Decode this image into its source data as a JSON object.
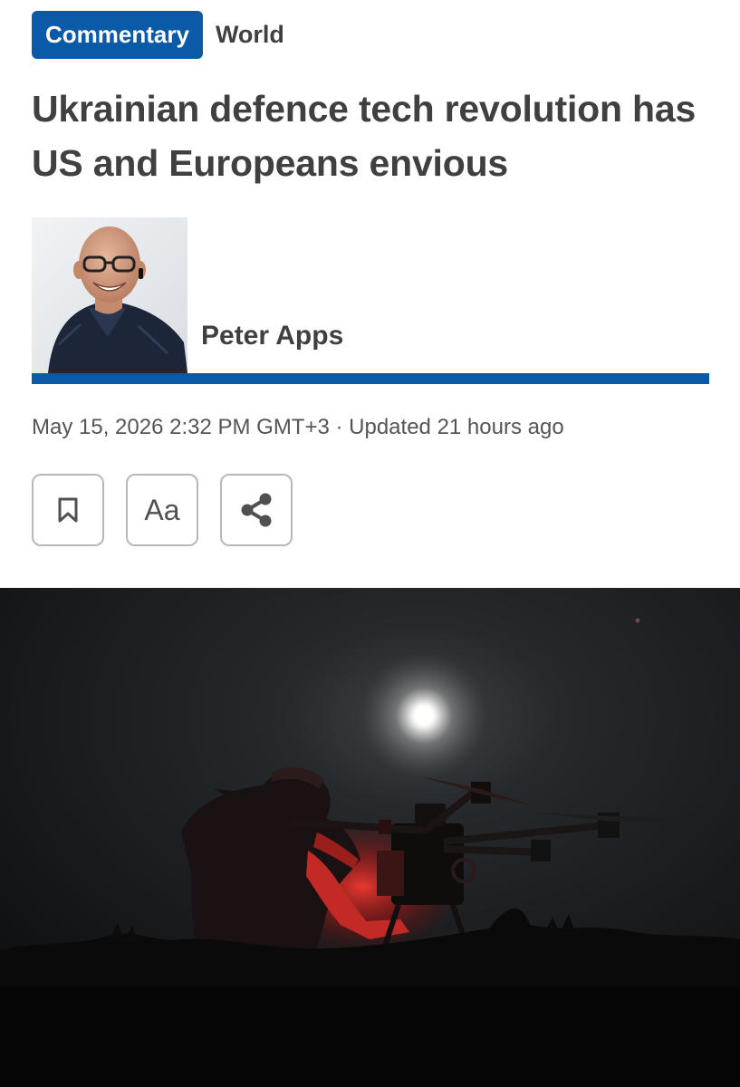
{
  "tags": {
    "primary": "Commentary",
    "secondary": "World"
  },
  "headline": "Ukrainian defence tech revolution has US and Europeans envious",
  "author": {
    "name": "Peter Apps"
  },
  "dateline": "May 15, 2026 2:32 PM GMT+3 · Updated 21 hours ago",
  "toolbar": {
    "font_size_label": "Aa",
    "bookmark_icon": "bookmark-icon",
    "share_icon": "share-icon"
  },
  "colors": {
    "accent": "#0a5aa8",
    "text": "#404040",
    "muted": "#555555",
    "border": "#b8b8b8"
  }
}
